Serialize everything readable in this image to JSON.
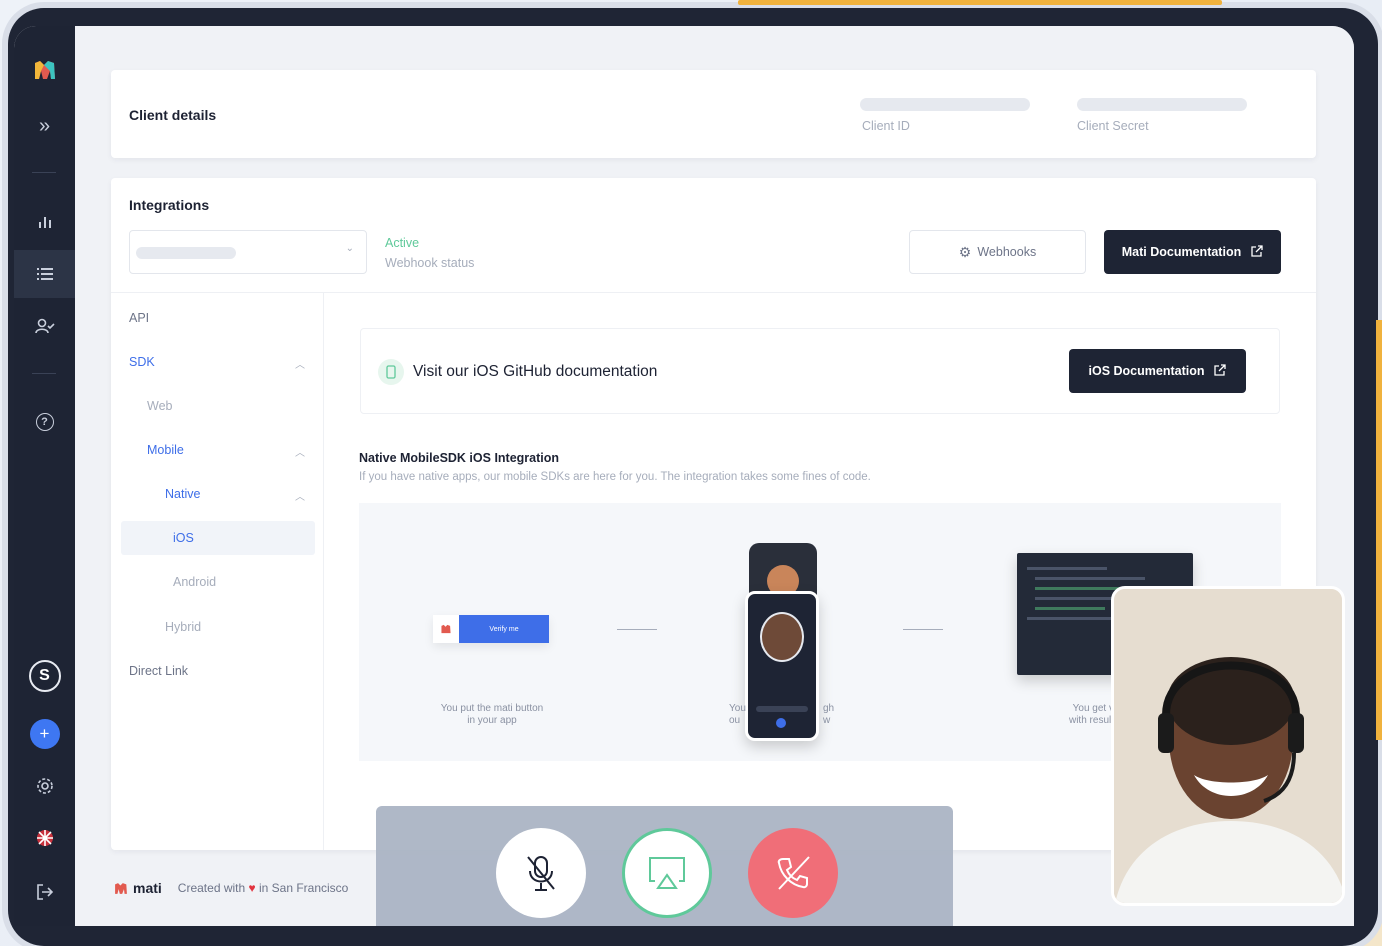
{
  "sidebar": {
    "expand_label": "»",
    "help_label": "?",
    "account_initial": "S",
    "plus_label": "+"
  },
  "client_details": {
    "title": "Client details",
    "client_id_label": "Client ID",
    "client_secret_label": "Client Secret"
  },
  "integrations": {
    "title": "Integrations",
    "status_value": "Active",
    "status_label": "Webhook status",
    "webhooks_button": "Webhooks",
    "docs_button": "Mati Documentation"
  },
  "nav": {
    "api": "API",
    "sdk": "SDK",
    "web": "Web",
    "mobile": "Mobile",
    "native": "Native",
    "ios": "iOS",
    "android": "Android",
    "hybrid": "Hybrid",
    "direct_link": "Direct Link"
  },
  "github_card": {
    "text": "Visit our iOS GitHub documentation",
    "button": "iOS Documentation"
  },
  "native_section": {
    "title": "Native MobileSDK iOS Integration",
    "subtitle": "If you have native apps, our mobile SDKs are here for you. The integration takes some fines of code."
  },
  "flow": {
    "verify_button": "Verify me",
    "step1_line1": "You put the mati button",
    "step1_line2": "in your app",
    "step2_line1": "You",
    "step2_line1_end": "gh",
    "step2_line2": "ou",
    "step2_line2_end": "w",
    "step3_line1": "You get v",
    "step3_line2": "with result"
  },
  "footer": {
    "brand": "mati",
    "credit_prefix": "Created with",
    "credit_suffix": "in San Francisco"
  },
  "colors": {
    "accent": "#3e6ee8",
    "dark": "#1e2434",
    "active_green": "#5fc99a",
    "end_call": "#f06e78"
  }
}
